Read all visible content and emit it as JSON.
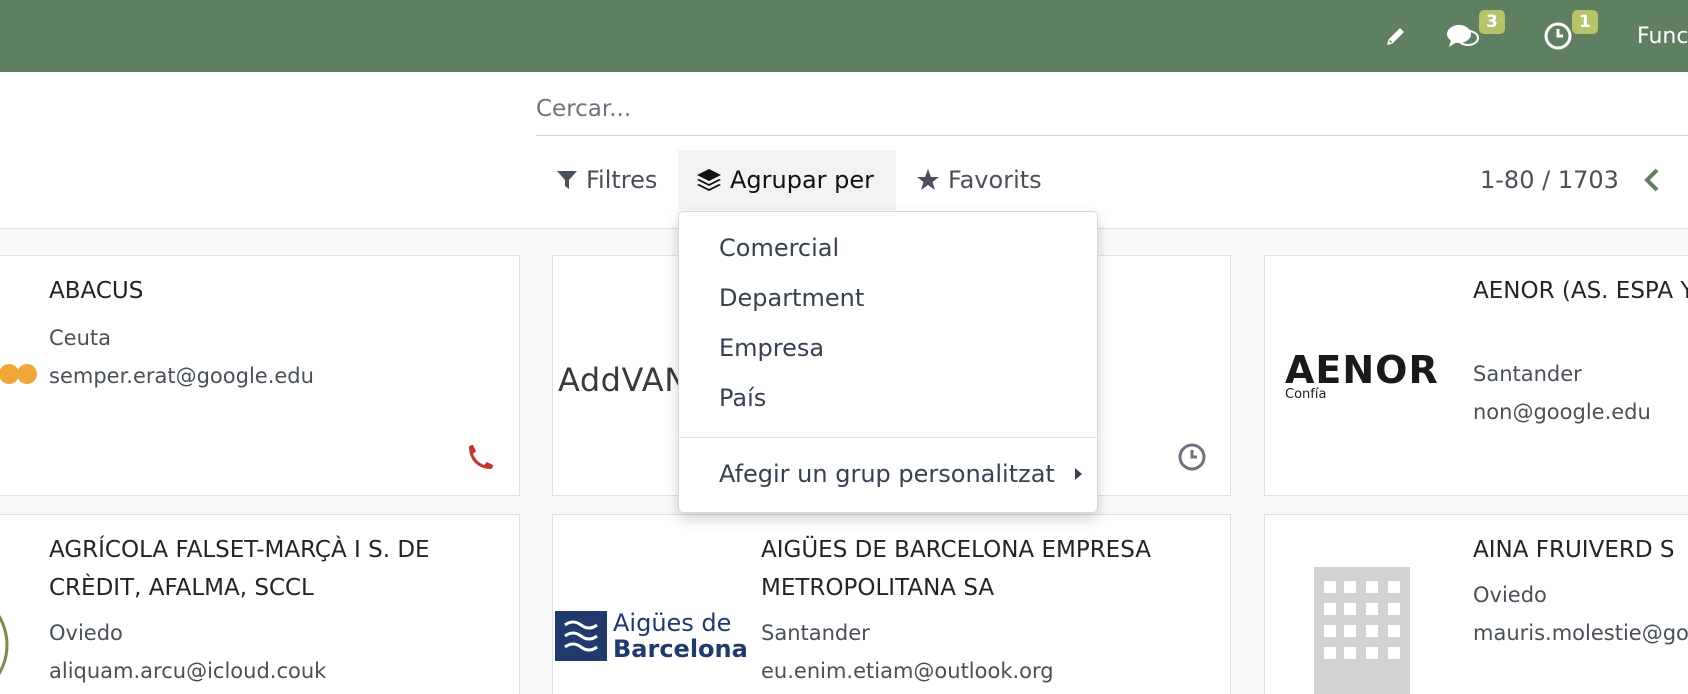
{
  "navbar": {
    "user_name": "Func",
    "messages_badge": "3",
    "activities_badge": "1",
    "icons": [
      "pencil-icon",
      "chat-icon",
      "clock-icon"
    ]
  },
  "search": {
    "placeholder": "Cercar..."
  },
  "toolbar": {
    "filters_label": "Filtres",
    "group_by_label": "Agrupar per",
    "favorites_label": "Favorits",
    "pager": "1-80 / 1703"
  },
  "group_by_menu": {
    "items": [
      "Comercial",
      "Department",
      "Empresa",
      "País"
    ],
    "custom_group_label": "Afegir un grup personalitzat"
  },
  "cards": [
    {
      "title": "ABACUS",
      "city": "Ceuta",
      "email": "semper.erat@google.edu"
    },
    {
      "logo_text": "AddVAN"
    },
    {
      "title": "AENOR (AS. ESPA Y CERTIFICACION",
      "city": "Santander",
      "email": "non@google.edu",
      "logo_text": "AENOR",
      "logo_sub": "Confía"
    },
    {
      "title": "AGRÍCOLA FALSET-MARÇÀ I S. DE CRÈDIT, AFALMA, SCCL",
      "city": "Oviedo",
      "email": "aliquam.arcu@icloud.couk"
    },
    {
      "title": "AIGÜES DE BARCELONA EMPRESA METROPOLITANA SA",
      "city": "Santander",
      "email": "eu.enim.etiam@outlook.org",
      "logo_line1": "Aigües de",
      "logo_line2": "Barcelona"
    },
    {
      "title": "AINA FRUIVERD S",
      "city": "Oviedo",
      "email": "mauris.molestie@go"
    }
  ],
  "colors": {
    "navbar": "#5f7f61",
    "badge": "#b5c36b",
    "accent": "#5f7f61",
    "phone_icon": "#c0392b",
    "dot": "#f0a73a"
  }
}
